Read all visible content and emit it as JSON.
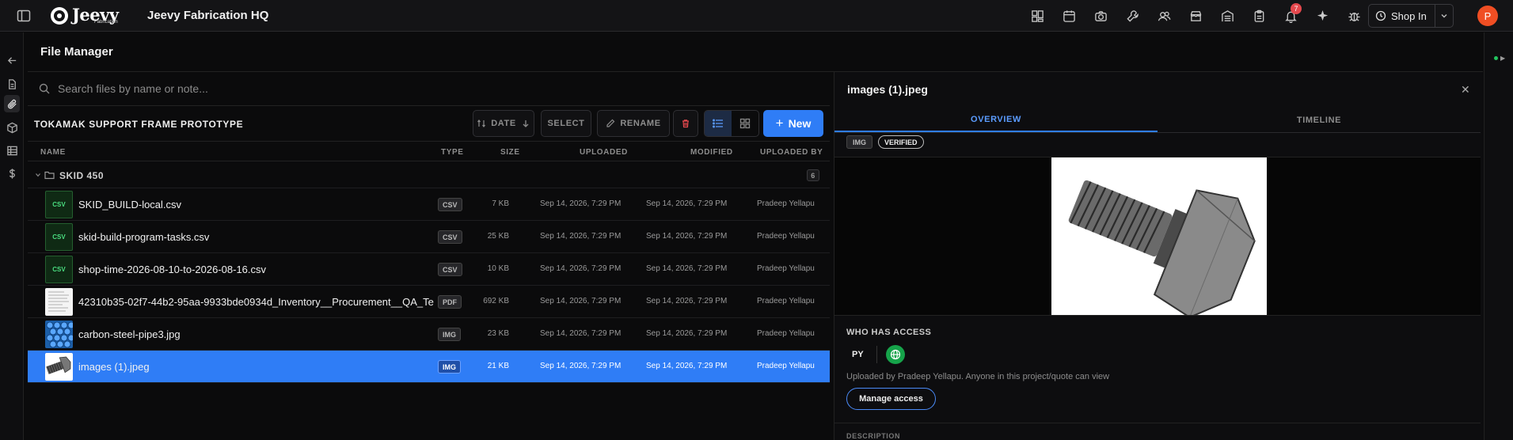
{
  "app": {
    "title": "Jeevy Fabrication HQ",
    "logo_text": "Jeevy",
    "logo_sub": "Fabrication"
  },
  "topbar": {
    "icons": [
      "dashboard-icon",
      "calendar-icon",
      "camera-icon",
      "wrench-icon",
      "users-icon",
      "store-icon",
      "warehouse-icon",
      "clipboard-icon",
      "bell-icon",
      "sparkle-icon",
      "bug-icon"
    ],
    "notification_count": "7",
    "shop_in_label": "Shop In",
    "avatar_initial": "P",
    "accent": "#2f7df6"
  },
  "file_manager": {
    "title": "File Manager",
    "search_placeholder": "Search files by name or note...",
    "project_title": "TOKAMAK SUPPORT FRAME PROTOTYPE",
    "toolbar": {
      "date_label": "DATE",
      "select_label": "SELECT",
      "rename_label": "RENAME",
      "new_label": "New"
    },
    "columns": [
      "NAME",
      "TYPE",
      "SIZE",
      "UPLOADED",
      "MODIFIED",
      "UPLOADED BY"
    ],
    "group": {
      "name": "SKID 450",
      "count": "6"
    },
    "files": [
      {
        "name": "SKID_BUILD-local.csv",
        "type": "CSV",
        "size": "7 KB",
        "uploaded": "Sep 14, 2026, 7:29 PM",
        "modified": "Sep 14, 2026, 7:29 PM",
        "by": "Pradeep Yellapu",
        "thumb": "CSV"
      },
      {
        "name": "skid-build-program-tasks.csv",
        "type": "CSV",
        "size": "25 KB",
        "uploaded": "Sep 14, 2026, 7:29 PM",
        "modified": "Sep 14, 2026, 7:29 PM",
        "by": "Pradeep Yellapu",
        "thumb": "CSV"
      },
      {
        "name": "shop-time-2026-08-10-to-2026-08-16.csv",
        "type": "CSV",
        "size": "10 KB",
        "uploaded": "Sep 14, 2026, 7:29 PM",
        "modified": "Sep 14, 2026, 7:29 PM",
        "by": "Pradeep Yellapu",
        "thumb": "CSV"
      },
      {
        "name": "42310b35-02f7-44b2-95aa-9933bde0934d_Inventory__Procurement__QA_Te",
        "type": "PDF",
        "size": "692 KB",
        "uploaded": "Sep 14, 2026, 7:29 PM",
        "modified": "Sep 14, 2026, 7:29 PM",
        "by": "Pradeep Yellapu",
        "thumb": ""
      },
      {
        "name": "carbon-steel-pipe3.jpg",
        "type": "IMG",
        "size": "23 KB",
        "uploaded": "Sep 14, 2026, 7:29 PM",
        "modified": "Sep 14, 2026, 7:29 PM",
        "by": "Pradeep Yellapu",
        "thumb": ""
      },
      {
        "name": "images (1).jpeg",
        "type": "IMG",
        "size": "21 KB",
        "uploaded": "Sep 14, 2026, 7:29 PM",
        "modified": "Sep 14, 2026, 7:29 PM",
        "by": "Pradeep Yellapu",
        "thumb": ""
      }
    ]
  },
  "detail": {
    "title": "images (1).jpeg",
    "tabs": [
      "OVERVIEW",
      "TIMELINE"
    ],
    "chips": [
      "IMG",
      "VERIFIED"
    ],
    "access_title": "WHO HAS ACCESS",
    "access_initials": "PY",
    "uploaded_note": "Uploaded by Pradeep Yellapu. Anyone in this project/quote can view",
    "manage_label": "Manage access",
    "description_label": "DESCRIPTION"
  }
}
